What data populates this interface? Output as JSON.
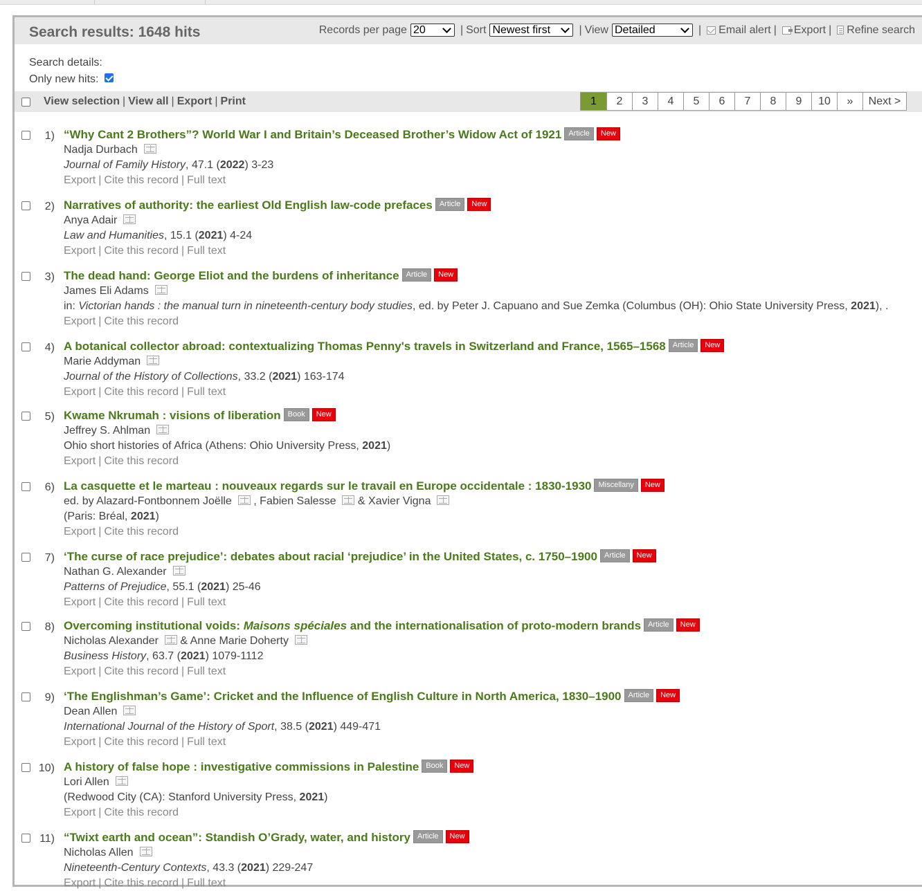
{
  "header": {
    "title": "Search results: 1648 hits",
    "records_label": "Records per page",
    "records_value": "20",
    "sort_label": "Sort",
    "sort_value": "Newest first",
    "view_label": "View",
    "view_value": "Detailed",
    "email_alert": "Email alert",
    "export": "Export",
    "refine": "Refine search"
  },
  "details": {
    "label": "Search details:",
    "only_new": "Only new hits:"
  },
  "toolbar": {
    "view_selection": "View selection",
    "view_all": "View all",
    "export": "Export",
    "print": "Print"
  },
  "pager": [
    "1",
    "2",
    "3",
    "4",
    "5",
    "6",
    "7",
    "8",
    "9",
    "10",
    "»",
    "Next >"
  ],
  "actions": {
    "export": "Export",
    "cite": "Cite this record",
    "full": "Full text"
  },
  "results": [
    {
      "num": "1)",
      "title": "“Why Cant 2 Brothers”? World War I and Britain’s Deceased Brother’s Widow Act of 1921",
      "type": "Article",
      "new": "New",
      "authors_prefix": "",
      "authors": [
        "Nadja Durbach"
      ],
      "src_italic": "Journal of Family History",
      "src_mid": ", 47.1 (",
      "year": "2022",
      "src_tail": ") 3-23",
      "full": true
    },
    {
      "num": "2)",
      "title": "Narratives of authority: the earliest Old English law-code prefaces",
      "type": "Article",
      "new": "New",
      "authors_prefix": "",
      "authors": [
        "Anya Adair"
      ],
      "src_italic": "Law and Humanities",
      "src_mid": ", 15.1 (",
      "year": "2021",
      "src_tail": ") 4-24",
      "full": true
    },
    {
      "num": "3)",
      "title": "The dead hand: George Eliot and the burdens of inheritance",
      "type": "Article",
      "new": "New",
      "authors_prefix": "",
      "authors": [
        "James Eli Adams"
      ],
      "src_pre": "in: ",
      "src_italic": "Victorian hands : the manual turn in nineteenth-century body studies",
      "src_mid": ", ed. by Peter J. Capuano and Sue Zemka (Columbus (OH): Ohio State University Press, ",
      "year": "2021",
      "src_tail": "), .",
      "full": false
    },
    {
      "num": "4)",
      "title": "A botanical collector abroad: contextualizing Thomas Penny's travels in Switzerland and France, 1565–1568",
      "type": "Article",
      "new": "New",
      "authors_prefix": "",
      "authors": [
        "Marie Addyman"
      ],
      "src_italic": "Journal of the History of Collections",
      "src_mid": ", 33.2 (",
      "year": "2021",
      "src_tail": ") 163-174",
      "full": true
    },
    {
      "num": "5)",
      "title": "Kwame Nkrumah : visions of liberation",
      "type": "Book",
      "new": "New",
      "authors_prefix": "",
      "authors": [
        "Jeffrey S. Ahlman"
      ],
      "src_italic": "",
      "src_mid": "Ohio short histories of Africa (Athens: Ohio University Press, ",
      "year": "2021",
      "src_tail": ")",
      "full": false
    },
    {
      "num": "6)",
      "title": "La casquette et le marteau : nouveaux regards sur le travail en Europe occidentale : 1830-1930",
      "type": "Miscellany",
      "new": "New",
      "authors_prefix": "ed. by ",
      "authors": [
        "Alazard-Fontbonnem Joëlle",
        ", Fabien Salesse",
        "& Xavier Vigna"
      ],
      "src_italic": "",
      "src_mid": "(Paris: Bréal, ",
      "year": "2021",
      "src_tail": ")",
      "full": false
    },
    {
      "num": "7)",
      "title": "‘The curse of race prejudice’: debates about racial ‘prejudice’ in the United States, c. 1750–1900",
      "type": "Article",
      "new": "New",
      "authors_prefix": "",
      "authors": [
        "Nathan G. Alexander"
      ],
      "src_italic": "Patterns of Prejudice",
      "src_mid": ", 55.1 (",
      "year": "2021",
      "src_tail": ") 25-46",
      "full": true
    },
    {
      "num": "8)",
      "title_a": "Overcoming institutional voids: ",
      "title_i": "Maisons spéciales",
      "title_b": " and the internationalisation of proto-modern brands",
      "type": "Article",
      "new": "New",
      "authors_prefix": "",
      "authors": [
        "Nicholas Alexander",
        "& Anne Marie Doherty"
      ],
      "src_italic": "Business History",
      "src_mid": ", 63.7 (",
      "year": "2021",
      "src_tail": ") 1079-1112",
      "full": true
    },
    {
      "num": "9)",
      "title": "‘The Englishman’s Game’: Cricket and the Influence of English Culture in North America, 1830–1900",
      "type": "Article",
      "new": "New",
      "authors_prefix": "",
      "authors": [
        "Dean Allen"
      ],
      "src_italic": "International Journal of the History of Sport",
      "src_mid": ", 38.5 (",
      "year": "2021",
      "src_tail": ") 449-471",
      "full": true
    },
    {
      "num": "10)",
      "title": "A history of false hope : investigative commissions in Palestine",
      "type": "Book",
      "new": "New",
      "authors_prefix": "",
      "authors": [
        "Lori Allen"
      ],
      "src_italic": "",
      "src_mid": "(Redwood City (CA): Stanford University Press, ",
      "year": "2021",
      "src_tail": ")",
      "full": false
    },
    {
      "num": "11)",
      "title": "“Twixt earth and ocean”: Standish O’Grady, water, and history",
      "type": "Article",
      "new": "New",
      "authors_prefix": "",
      "authors": [
        "Nicholas Allen"
      ],
      "src_italic": "Nineteenth-Century Contexts",
      "src_mid": ", 43.3 (",
      "year": "2021",
      "src_tail": ") 229-247",
      "full": true
    }
  ]
}
